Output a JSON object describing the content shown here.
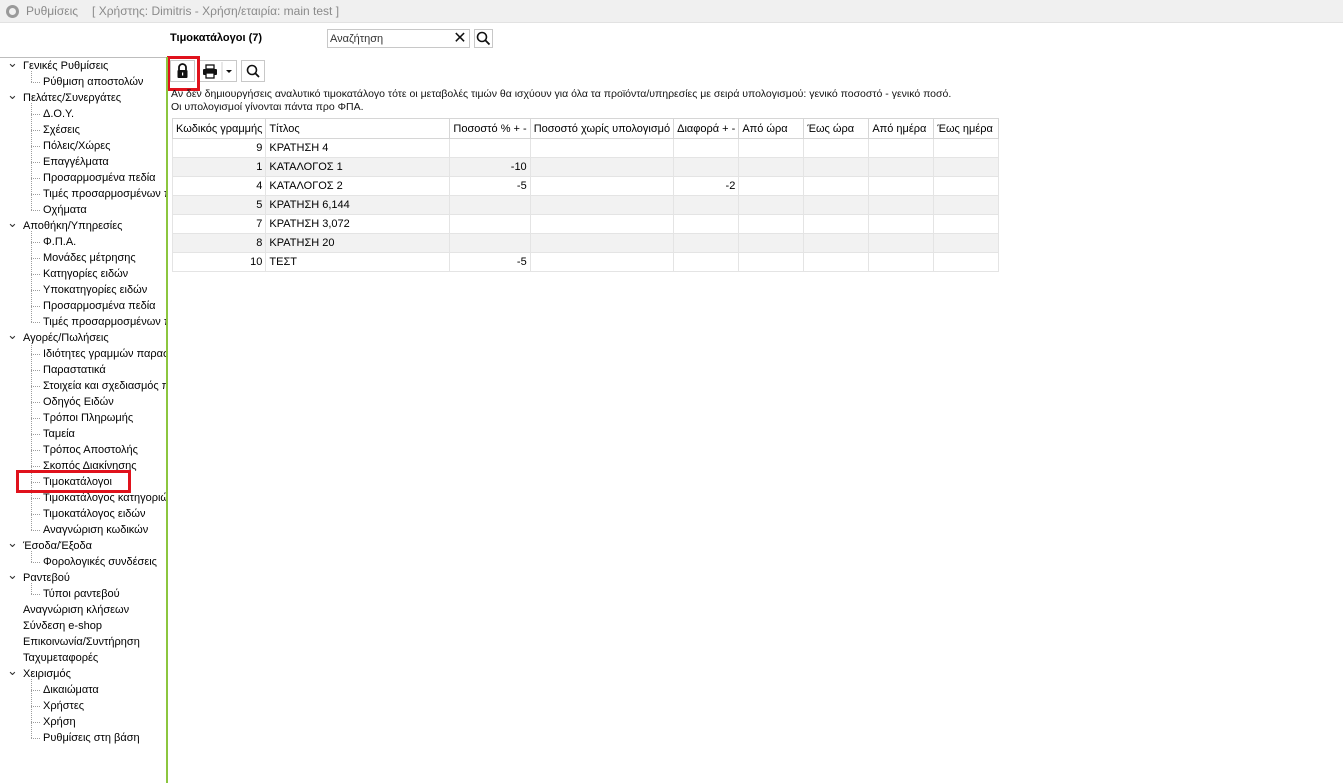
{
  "window": {
    "title": "Ρυθμίσεις",
    "context": "[ Χρήστης: Dimitris - Χρήση/εταιρία: main test ]"
  },
  "sidebar": {
    "items": [
      {
        "label": "Γενικές Ρυθμίσεις",
        "level": 0,
        "expanded": true
      },
      {
        "label": "Ρύθμιση αποστολών",
        "level": 1
      },
      {
        "label": "Πελάτες/Συνεργάτες",
        "level": 0,
        "expanded": true
      },
      {
        "label": "Δ.Ο.Υ.",
        "level": 1
      },
      {
        "label": "Σχέσεις",
        "level": 1
      },
      {
        "label": "Πόλεις/Χώρες",
        "level": 1
      },
      {
        "label": "Επαγγέλματα",
        "level": 1
      },
      {
        "label": "Προσαρμοσμένα πεδία",
        "level": 1
      },
      {
        "label": "Τιμές προσαρμοσμένων π",
        "level": 1
      },
      {
        "label": "Οχήματα",
        "level": 1
      },
      {
        "label": "Αποθήκη/Υπηρεσίες",
        "level": 0,
        "expanded": true
      },
      {
        "label": "Φ.Π.Α.",
        "level": 1
      },
      {
        "label": "Μονάδες μέτρησης",
        "level": 1
      },
      {
        "label": "Κατηγορίες ειδών",
        "level": 1
      },
      {
        "label": "Υποκατηγορίες ειδών",
        "level": 1
      },
      {
        "label": "Προσαρμοσμένα πεδία",
        "level": 1
      },
      {
        "label": "Τιμές προσαρμοσμένων π",
        "level": 1
      },
      {
        "label": "Αγορές/Πωλήσεις",
        "level": 0,
        "expanded": true
      },
      {
        "label": "Ιδιότητες γραμμών παραστ",
        "level": 1
      },
      {
        "label": "Παραστατικά",
        "level": 1
      },
      {
        "label": "Στοιχεία και σχεδιασμός π",
        "level": 1
      },
      {
        "label": "Οδηγός Ειδών",
        "level": 1
      },
      {
        "label": "Τρόποι Πληρωμής",
        "level": 1
      },
      {
        "label": "Ταμεία",
        "level": 1
      },
      {
        "label": "Τρόπος Αποστολής",
        "level": 1
      },
      {
        "label": "Σκοπός Διακίνησης",
        "level": 1
      },
      {
        "label": "Τιμοκατάλογοι",
        "level": 1,
        "selected": true
      },
      {
        "label": "Τιμοκατάλογος κατηγοριώ",
        "level": 1
      },
      {
        "label": "Τιμοκατάλογος ειδών",
        "level": 1
      },
      {
        "label": "Αναγνώριση κωδικών",
        "level": 1
      },
      {
        "label": "Έσοδα/Έξοδα",
        "level": 0,
        "expanded": true
      },
      {
        "label": "Φορολογικές συνδέσεις",
        "level": 1
      },
      {
        "label": "Ραντεβού",
        "level": 0,
        "expanded": true
      },
      {
        "label": "Τύποι ραντεβού",
        "level": 1
      },
      {
        "label": "Αναγνώριση κλήσεων",
        "level": 0
      },
      {
        "label": "Σύνδεση e-shop",
        "level": 0
      },
      {
        "label": "Επικοινωνία/Συντήρηση",
        "level": 0
      },
      {
        "label": "Ταχυμεταφορές",
        "level": 0
      },
      {
        "label": "Χειρισμός",
        "level": 0,
        "expanded": true
      },
      {
        "label": "Δικαιώματα",
        "level": 1
      },
      {
        "label": "Χρήστες",
        "level": 1
      },
      {
        "label": "Χρήση",
        "level": 1
      },
      {
        "label": "Ρυθμίσεις στη βάση",
        "level": 1
      }
    ]
  },
  "main": {
    "title": "Τιμοκατάλογοι (7)",
    "search": {
      "value": "Αναζήτηση"
    },
    "toolbar": {
      "lock_icon": "lock-icon",
      "print_icon": "printer-icon",
      "search_icon": "magnifier-icon"
    },
    "info_line1": "Αν δεν δημιουργήσεις αναλυτικό τιμοκατάλογο τότε οι μεταβολές τιμών θα ισχύουν για όλα τα προϊόντα/υπηρεσίες με σειρά υπολογισμού: γενικό ποσοστό - γενικό ποσό.",
    "info_line2": "Οι υπολογισμοί γίνονται πάντα προ ΦΠΑ.",
    "table": {
      "columns": [
        "Κωδικός γραμμής",
        "Τίτλος",
        "Ποσοστό % + -",
        "Ποσοστό χωρίς υπολογισμό",
        "Διαφορά + -",
        "Από ώρα",
        "Έως ώρα",
        "Από ημέρα",
        "Έως ημέρα"
      ],
      "rows": [
        [
          "9",
          "ΚΡΑΤΗΣΗ 4",
          "",
          "",
          "",
          "",
          "",
          "",
          ""
        ],
        [
          "1",
          "ΚΑΤΑΛΟΓΟΣ 1",
          "-10",
          "",
          "",
          "",
          "",
          "",
          ""
        ],
        [
          "4",
          "ΚΑΤΑΛΟΓΟΣ 2",
          "-5",
          "",
          "-2",
          "",
          "",
          "",
          ""
        ],
        [
          "5",
          "ΚΡΑΤΗΣΗ 6,144",
          "",
          "",
          "",
          "",
          "",
          "",
          ""
        ],
        [
          "7",
          "ΚΡΑΤΗΣΗ 3,072",
          "",
          "",
          "",
          "",
          "",
          "",
          ""
        ],
        [
          "8",
          "ΚΡΑΤΗΣΗ 20",
          "",
          "",
          "",
          "",
          "",
          "",
          ""
        ],
        [
          "10",
          "ΤΕΣΤ",
          "-5",
          "",
          "",
          "",
          "",
          "",
          ""
        ]
      ]
    }
  },
  "colors": {
    "highlight": "#e0121c",
    "divider": "#8cc63f"
  }
}
